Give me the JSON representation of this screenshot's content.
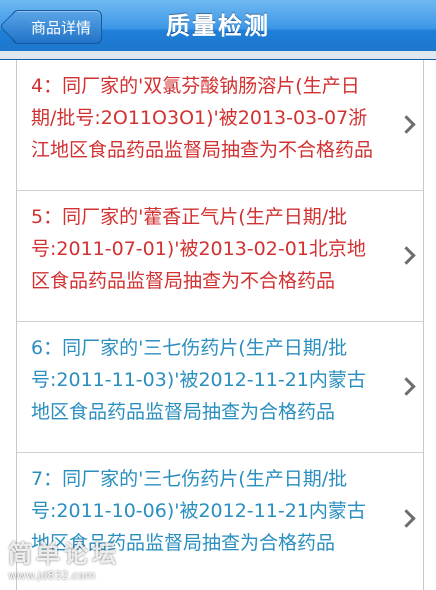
{
  "navbar": {
    "back_label": "商品详情",
    "title": "质量检测"
  },
  "items": [
    {
      "text": "4：同厂家的'双氯芬酸钠肠溶片(生产日期/批号:2O11O3O1)'被2013-03-07浙江地区食品药品监督局抽查为不合格药品",
      "status": "red"
    },
    {
      "text": "5：同厂家的'藿香正气片(生产日期/批号:2011-07-01)'被2013-02-01北京地区食品药品监督局抽查为不合格药品",
      "status": "red"
    },
    {
      "text": "6：同厂家的'三七伤药片(生产日期/批号:2011-11-03)'被2012-11-21内蒙古地区食品药品监督局抽查为合格药品",
      "status": "blue"
    },
    {
      "text": "7：同厂家的'三七伤药片(生产日期/批号:2011-10-06)'被2012-11-21内蒙古地区食品药品监督局抽查为合格药品",
      "status": "blue"
    }
  ],
  "watermark": {
    "big": "简单论坛",
    "small": "www.jd832.com"
  },
  "colors": {
    "fail": "#d23131",
    "pass": "#2a8fbf",
    "navbar": "#2f86d8"
  }
}
